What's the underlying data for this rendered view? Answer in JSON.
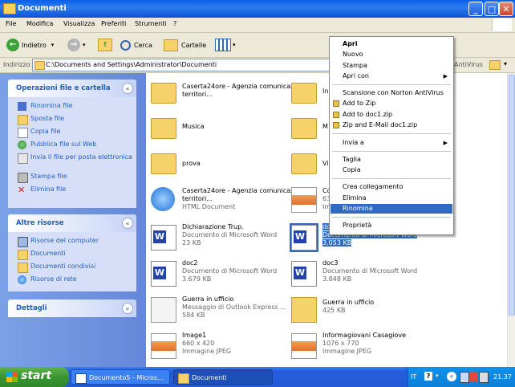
{
  "window": {
    "title": "Documenti"
  },
  "menu": [
    "File",
    "Modifica",
    "Visualizza",
    "Preferiti",
    "Strumenti",
    "?"
  ],
  "toolbar": {
    "back": "Indietro",
    "search": "Cerca",
    "folders": "Cartelle"
  },
  "address": {
    "label": "Indirizzo",
    "path": "C:\\Documents and Settings\\Administrator\\Documenti",
    "right_text": "AntiVirus"
  },
  "tasks_panel": {
    "title": "Operazioni file e cartella",
    "items": [
      "Rinomina file",
      "Sposta file",
      "Copia file",
      "Pubblica file sul Web",
      "Invia il file per posta elettronica",
      "Stampa file",
      "Elimina file"
    ]
  },
  "other_panel": {
    "title": "Altre risorse",
    "items": [
      "Risorse del computer",
      "Documenti",
      "Documenti condivisi",
      "Risorse di rete"
    ]
  },
  "details_panel": {
    "title": "Dettagli"
  },
  "files_left": [
    {
      "name": "Caserta24ore - Agenzia comunicazione territori...",
      "type": "",
      "size": "",
      "icon": "folder-icon"
    },
    {
      "name": "Musica",
      "type": "",
      "size": "",
      "icon": "music-folder-icon"
    },
    {
      "name": "prova",
      "type": "",
      "size": "",
      "icon": "folder-icon"
    },
    {
      "name": "Caserta24ore - Agenzia comunicazione territori...",
      "type": "HTML Document",
      "size": "",
      "icon": "ie-document-icon"
    },
    {
      "name": "Dichiarazione Trup.",
      "type": "Documento di Microsoft Word",
      "size": "23 KB",
      "icon": "word-document-icon"
    },
    {
      "name": "doc2",
      "type": "Documento di Microsoft Word",
      "size": "3.679 KB",
      "icon": "word-document-icon"
    },
    {
      "name": "Guerra in ufficio",
      "type": "Messaggio di Outlook Express ...",
      "size": "584 KB",
      "icon": "mail-icon"
    },
    {
      "name": "Image1",
      "type": "660 x 420",
      "size": "Immagine JPEG",
      "icon": "jpeg-image-icon"
    }
  ],
  "files_right": [
    {
      "name": "In",
      "type": "",
      "size": "",
      "icon": "folder-icon"
    },
    {
      "name": "M",
      "type": "",
      "size": "",
      "icon": "folder-icon"
    },
    {
      "name": "Vi",
      "type": "",
      "size": "",
      "icon": "folder-icon"
    },
    {
      "name": "Co",
      "type": "63",
      "size": "Im",
      "icon": "jpeg-image-icon"
    },
    {
      "name": "do",
      "type": "Documento di Microsoft Word",
      "size": "3.053 KB",
      "icon": "word-document-icon"
    },
    {
      "name": "doc3",
      "type": "Documento di Microsoft Word",
      "size": "3.848 KB",
      "icon": "word-document-icon"
    },
    {
      "name": "Guerra in ufficio",
      "type": "425 KB",
      "size": "",
      "icon": "zip-archive-icon"
    },
    {
      "name": "Informagiovani Casagiove",
      "type": "1076 x 770",
      "size": "Immagine JPEG",
      "icon": "jpeg-image-icon"
    }
  ],
  "context_menu": {
    "items": [
      {
        "label": "Apri",
        "bold": true
      },
      {
        "label": "Nuovo"
      },
      {
        "label": "Stampa"
      },
      {
        "label": "Apri con",
        "submenu": true
      },
      {
        "sep": true
      },
      {
        "label": "Scansione con Norton AntiVirus"
      },
      {
        "label": "Add to Zip",
        "icon": true
      },
      {
        "label": "Add to doc1.zip",
        "icon": true
      },
      {
        "label": "Zip and E-Mail doc1.zip",
        "icon": true
      },
      {
        "sep": true
      },
      {
        "label": "Invia a",
        "submenu": true
      },
      {
        "sep": true
      },
      {
        "label": "Taglia"
      },
      {
        "label": "Copia"
      },
      {
        "sep": true
      },
      {
        "label": "Crea collegamento"
      },
      {
        "label": "Elimina"
      },
      {
        "label": "Rinomina",
        "highlight": true
      },
      {
        "sep": true
      },
      {
        "label": "Proprietà"
      }
    ]
  },
  "taskbar": {
    "start": "start",
    "buttons": [
      "Documento5 - Micros...",
      "Documenti"
    ],
    "lang": "IT",
    "clock": "21.37"
  },
  "colors": {
    "selection": "#316ac5",
    "link": "#215dc6",
    "title_blue": "#0a5fe8"
  }
}
